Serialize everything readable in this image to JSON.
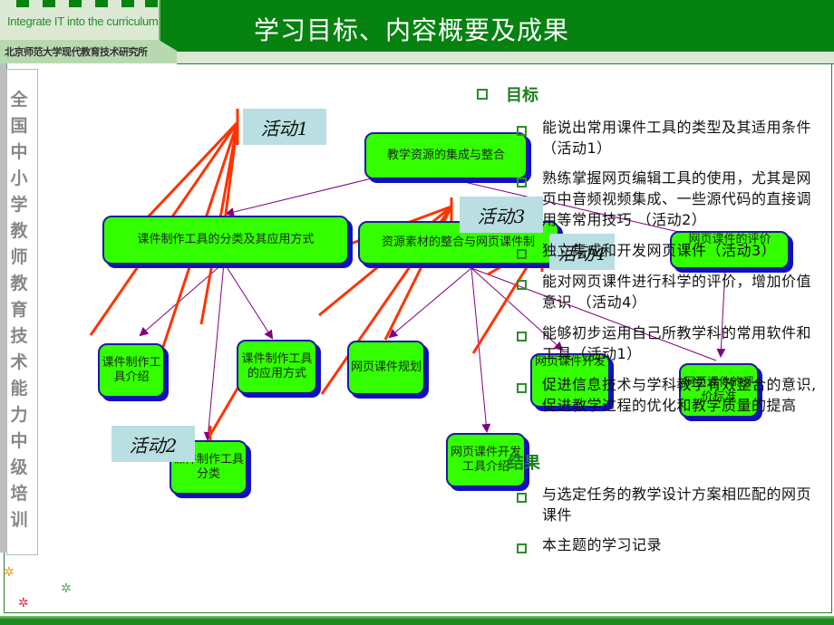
{
  "header": {
    "logo_en": "Integrate IT into the curriculum",
    "logo_cn": "北京师范大学现代教育技术研究所",
    "title": "学习目标、内容概要及成果"
  },
  "sidebar": {
    "vertical_text": [
      "全",
      "国",
      "中",
      "小",
      "学",
      "教",
      "师",
      "教",
      "育",
      "技",
      "术",
      "能",
      "力",
      "中",
      "级",
      "培",
      "训"
    ]
  },
  "diagram": {
    "nodes": [
      {
        "id": "root",
        "label": "教学资源的集成与整合"
      },
      {
        "id": "tools",
        "label": "课件制作工具的分类及其应用方式"
      },
      {
        "id": "web",
        "label": "资源素材的整合与网页课件制"
      },
      {
        "id": "intro",
        "label": "课件制作工具介绍"
      },
      {
        "id": "apply",
        "label": "课件制作工具的应用方式"
      },
      {
        "id": "classify",
        "label": "课件制作工具分类"
      },
      {
        "id": "plan",
        "label": "网页课件规划"
      },
      {
        "id": "devtools",
        "label": "网页课件开发工具介绍"
      },
      {
        "id": "dev",
        "label": "网页课件开发"
      },
      {
        "id": "eval",
        "label": "网页课件的评价"
      },
      {
        "id": "criteria",
        "label": "网页课件的评价标准"
      }
    ],
    "activity_labels": [
      "活动1",
      "活动2",
      "活动3",
      "活动4"
    ]
  },
  "objectives": {
    "title": "目标",
    "items": [
      "能说出常用课件工具的类型及其适用条件 （活动1）",
      "熟练掌握网页编辑工具的使用，尤其是网页中音频视频集成、一些源代码的直接调用等常用技巧 （活动2）",
      "独立集成和开发网页课件（活动3）",
      "能对网页课件进行科学的评价，增加价值意识 （活动4）",
      "能够初步运用自己所教学科的常用软件和工具（活动1）",
      "促进信息技术与学科教学有效整合的意识,促进教学过程的优化和教学质量的提高"
    ]
  },
  "results": {
    "title": "结果",
    "items": [
      "与选定任务的教学设计方案相匹配的网页课件",
      "本主题的学习记录"
    ]
  },
  "colors": {
    "header_green": "#05820f",
    "node_fill": "#33ff00",
    "node_border": "#1b1b9e",
    "activity_line": "#ff3300",
    "connector": "#800080",
    "label_bg": "#b9dfe2",
    "bullet": "#2e8b2e"
  }
}
